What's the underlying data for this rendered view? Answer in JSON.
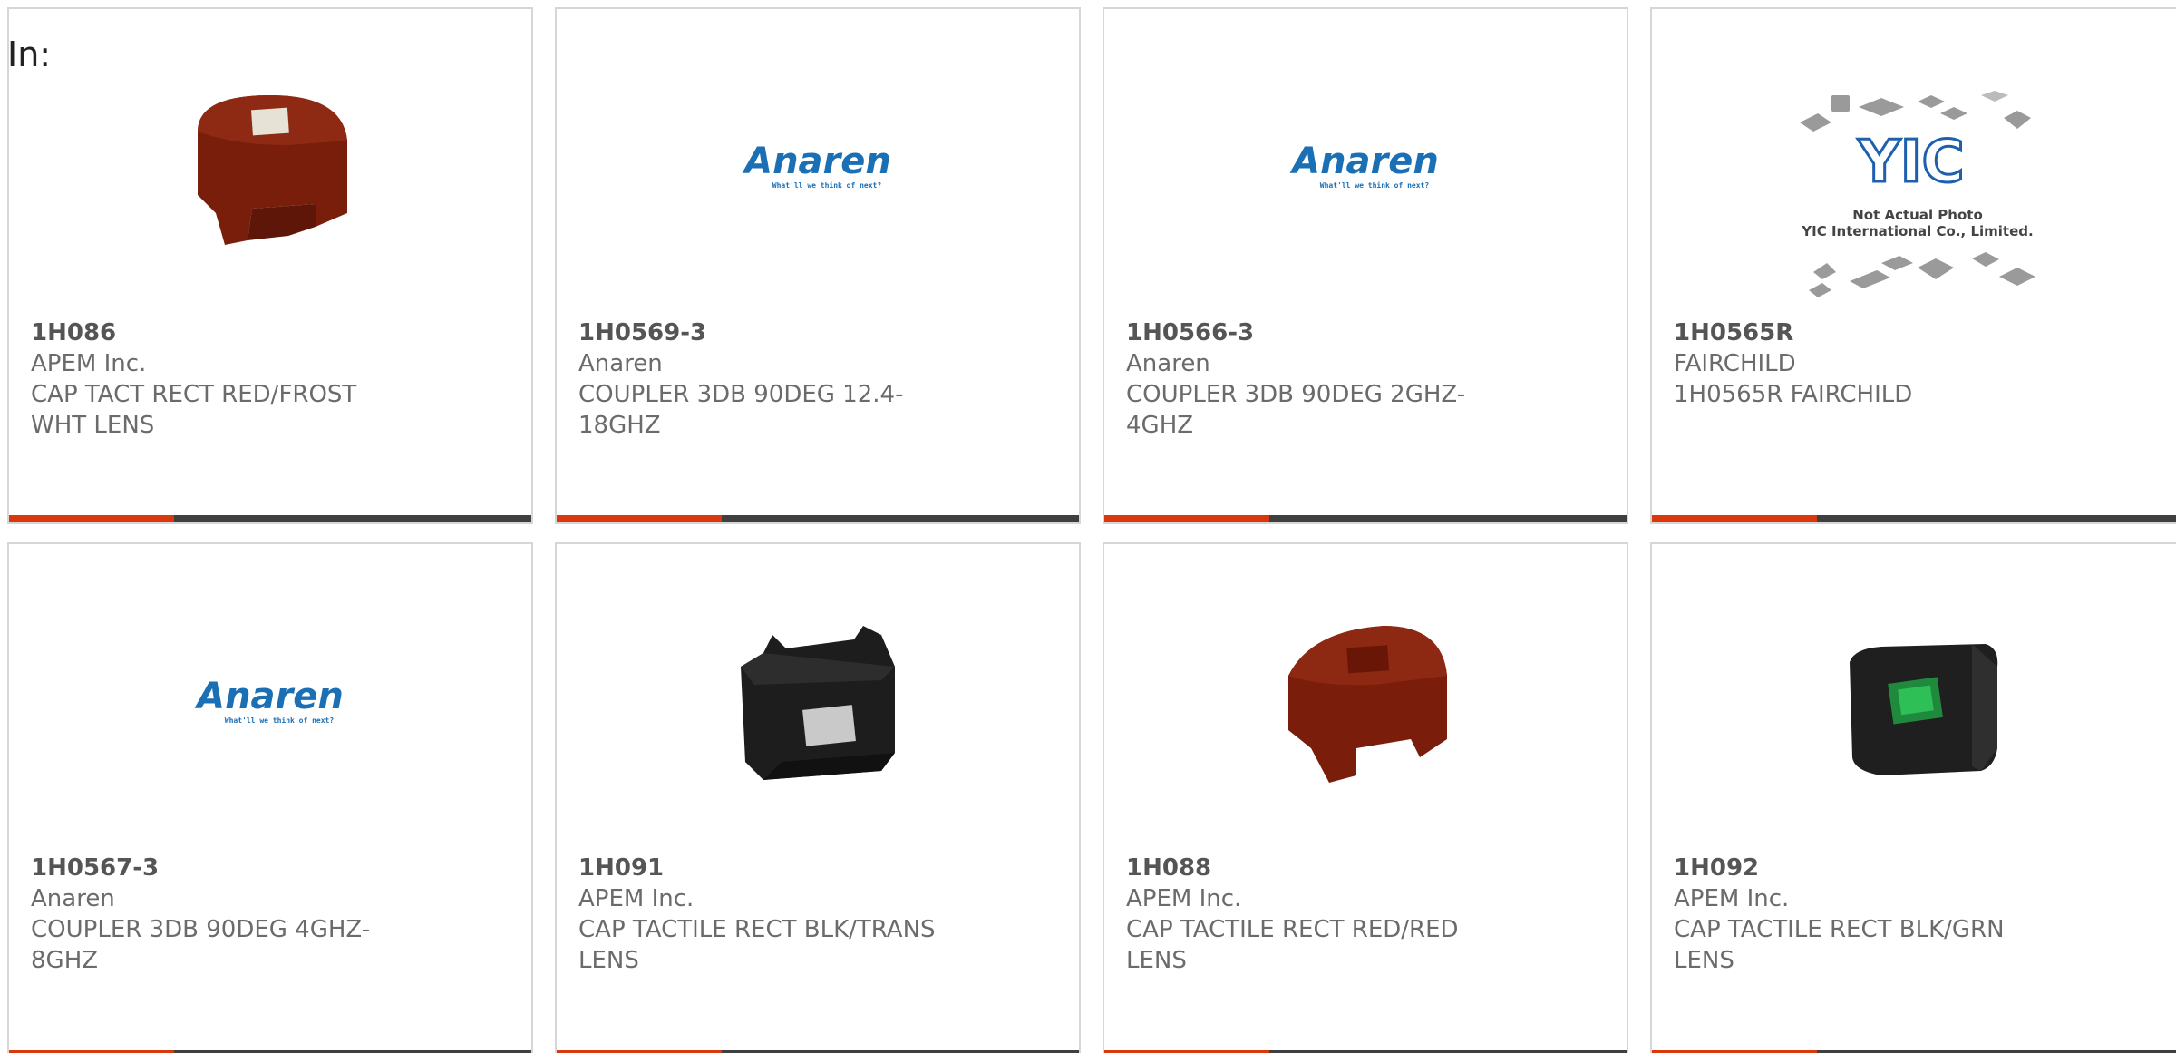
{
  "page": {
    "label": "In:"
  },
  "products": [
    {
      "part": "1H086",
      "maker": "APEM Inc.",
      "desc_lines": [
        "CAP TACT RECT RED/FROST",
        "WHT LENS"
      ],
      "image": "red-cap-frost"
    },
    {
      "part": "1H0569-3",
      "maker": "Anaren",
      "desc_lines": [
        "COUPLER 3DB 90DEG 12.4-",
        "18GHZ"
      ],
      "image": "anaren-logo"
    },
    {
      "part": "1H0566-3",
      "maker": "Anaren",
      "desc_lines": [
        "COUPLER 3DB 90DEG 2GHZ-",
        "4GHZ"
      ],
      "image": "anaren-logo"
    },
    {
      "part": "1H0565R",
      "maker": "FAIRCHILD",
      "desc_lines": [
        "1H0565R FAIRCHILD",
        ""
      ],
      "image": "yic-placeholder"
    },
    {
      "part": "1H0567-3",
      "maker": "Anaren",
      "desc_lines": [
        "COUPLER 3DB 90DEG 4GHZ-",
        "8GHZ"
      ],
      "image": "anaren-logo"
    },
    {
      "part": "1H091",
      "maker": "APEM Inc.",
      "desc_lines": [
        "CAP TACTILE RECT BLK/TRANS",
        "LENS"
      ],
      "image": "black-cap-trans"
    },
    {
      "part": "1H088",
      "maker": "APEM Inc.",
      "desc_lines": [
        "CAP TACTILE RECT RED/RED",
        "LENS"
      ],
      "image": "red-cap-red"
    },
    {
      "part": "1H092",
      "maker": "APEM Inc.",
      "desc_lines": [
        "CAP TACTILE RECT BLK/GRN",
        "LENS"
      ],
      "image": "black-cap-green"
    }
  ],
  "logo_text": {
    "anaren": "Anaren",
    "anaren_tagline": "What'll we think of next?",
    "yic_line1": "Not Actual Photo",
    "yic_line2": "YIC International Co., Limited."
  },
  "colors": {
    "accent": "#d9380d",
    "bar": "#3f3f3f",
    "border": "#d6d6d6",
    "anaren_blue": "#1a6fb5",
    "yic_blue": "#1e5fae"
  }
}
